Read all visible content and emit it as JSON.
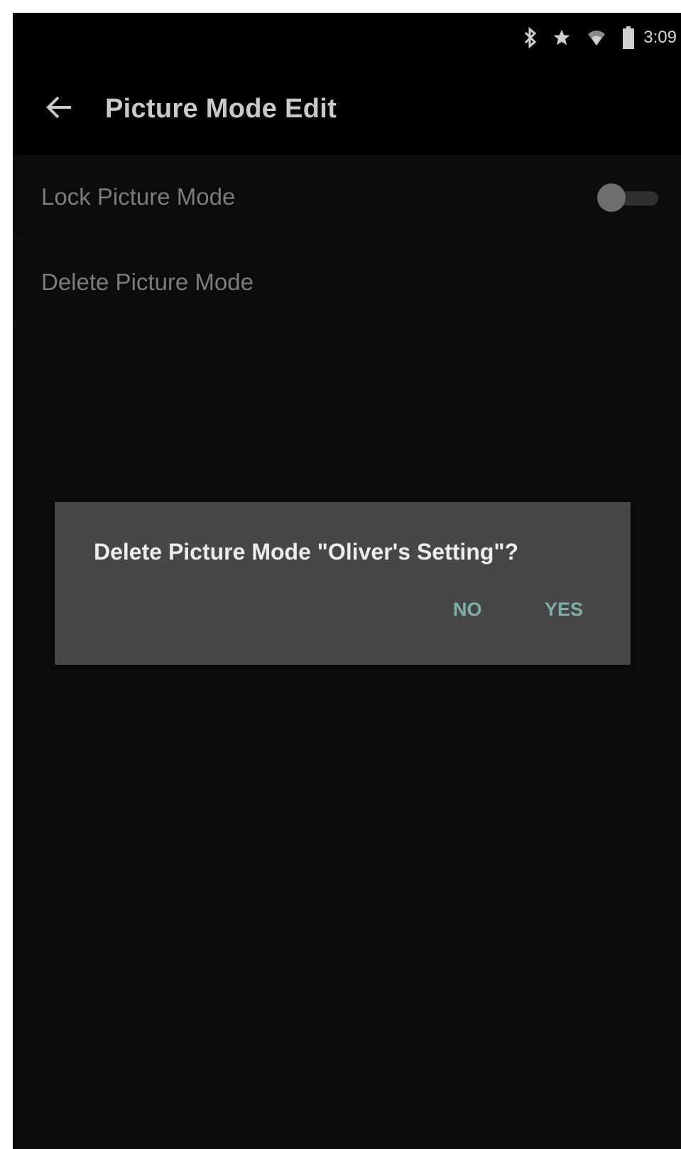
{
  "status_bar": {
    "icons": [
      "bluetooth-icon",
      "star-icon",
      "wifi-icon",
      "battery-icon"
    ],
    "time": "3:09"
  },
  "app_bar": {
    "back_icon": "back-arrow-icon",
    "title": "Picture Mode Edit"
  },
  "settings": {
    "lock_label": "Lock Picture Mode",
    "lock_enabled": false,
    "delete_label": "Delete Picture Mode"
  },
  "dialog": {
    "message": "Delete Picture Mode \"Oliver's Setting\"?",
    "no_label": "NO",
    "yes_label": "YES"
  },
  "colors": {
    "background": "#0c0c0c",
    "appbar": "#000000",
    "dialog": "#474747",
    "accent": "#7fb0a6"
  }
}
